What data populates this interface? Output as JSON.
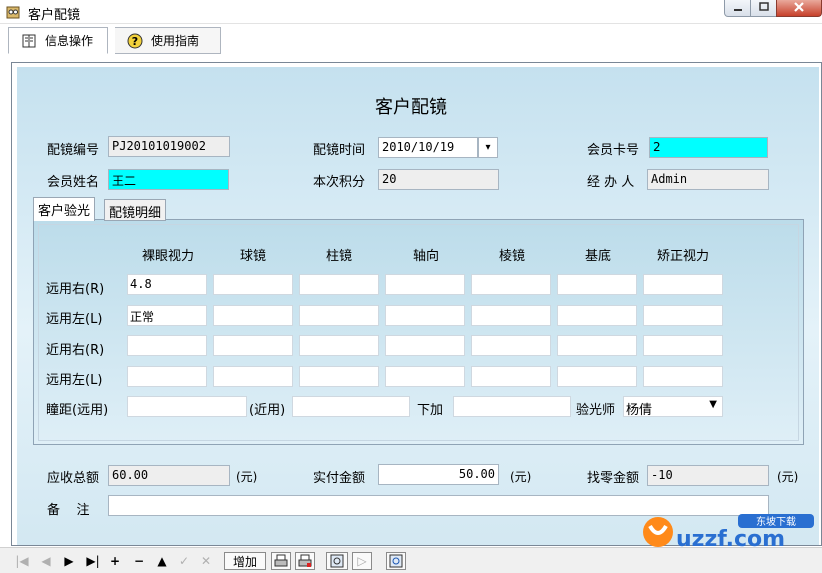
{
  "window": {
    "title": "客户配镜"
  },
  "tabs": [
    {
      "label": "信息操作",
      "icon": "book-icon"
    },
    {
      "label": "使用指南",
      "icon": "help-icon"
    }
  ],
  "form": {
    "heading": "客户配镜",
    "order_no_label": "配镜编号",
    "order_no": "PJ20101019002",
    "time_label": "配镜时间",
    "time": "2010/10/19",
    "card_label": "会员卡号",
    "card": "2",
    "name_label": "会员姓名",
    "name": "王二",
    "points_label": "本次积分",
    "points": "20",
    "handler_label": "经 办 人",
    "handler": "Admin"
  },
  "subtabs": [
    "客户验光",
    "配镜明细"
  ],
  "grid": {
    "columns": [
      "裸眼视力",
      "球镜",
      "柱镜",
      "轴向",
      "棱镜",
      "基底",
      "矫正视力"
    ],
    "rows": [
      {
        "label": "远用右(R)",
        "values": [
          "4.8",
          "",
          "",
          "",
          "",
          "",
          ""
        ]
      },
      {
        "label": "远用左(L)",
        "values": [
          "正常",
          "",
          "",
          "",
          "",
          "",
          ""
        ]
      },
      {
        "label": "近用右(R)",
        "values": [
          "",
          "",
          "",
          "",
          "",
          "",
          ""
        ]
      },
      {
        "label": "远用左(L)",
        "values": [
          "",
          "",
          "",
          "",
          "",
          "",
          ""
        ]
      }
    ],
    "pd_far_label": "瞳距(远用)",
    "pd_far": "",
    "pd_near_label": "(近用)",
    "pd_near": "",
    "add_label": "下加",
    "add": "",
    "optometrist_label": "验光师",
    "optometrist": "杨倩"
  },
  "totals": {
    "due_label": "应收总额",
    "due": "60.00",
    "unit1": "(元)",
    "paid_label": "实付金额",
    "paid": "50.00",
    "unit2": "(元)",
    "change_label": "找零金额",
    "change": "-10",
    "unit3": "(元)",
    "remark_label": "备    注",
    "remark": ""
  },
  "toolbar": {
    "add_label": "增加"
  },
  "watermark": {
    "text": "uzzf.com",
    "badge": "东坡下载"
  },
  "colors": {
    "highlight": "#00ffff",
    "panel": "#c5e1ef"
  }
}
